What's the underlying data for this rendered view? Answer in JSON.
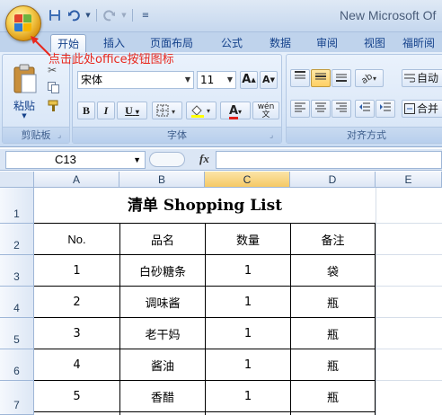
{
  "titlebar": {
    "title": "New Microsoft Of",
    "colors": {
      "office_button": "#f6cf52",
      "title_bg": "#c5d7ee"
    }
  },
  "ribbon_tabs": [
    "开始",
    "插入",
    "页面布局",
    "公式",
    "数据",
    "审阅",
    "视图",
    "福昕阅"
  ],
  "active_tab": "开始",
  "clipboard": {
    "paste_label": "粘贴",
    "group_label": "剪贴板"
  },
  "font": {
    "name": "宋体",
    "size": "11",
    "grow": "A",
    "shrink": "A",
    "group_label": "字体",
    "phonetic": "wén 文"
  },
  "font_buttons": {
    "bold": "B",
    "italic": "I",
    "underline": "U",
    "underline_arrow": "▾",
    "font_color": "A"
  },
  "alignment": {
    "wrap_label": "自动",
    "merge_label": "合并",
    "group_label": "对齐方式"
  },
  "annotation": "点击此处office按钮图标",
  "formula_bar": {
    "name_box": "C13",
    "fx": "fx",
    "value": ""
  },
  "columns": [
    "A",
    "B",
    "C",
    "D",
    "E"
  ],
  "rows": [
    "1",
    "2",
    "3",
    "4",
    "5",
    "6",
    "7"
  ],
  "selected_column": "C",
  "table": {
    "title": "清单 Shopping List",
    "headers": [
      "No.",
      "品名",
      "数量",
      "备注"
    ],
    "rows": [
      [
        "1",
        "白砂糖条",
        "1",
        "袋"
      ],
      [
        "2",
        "调味酱",
        "1",
        "瓶"
      ],
      [
        "3",
        "老干妈",
        "1",
        "瓶"
      ],
      [
        "4",
        "酱油",
        "1",
        "瓶"
      ],
      [
        "5",
        "香醋",
        "1",
        "瓶"
      ]
    ]
  }
}
